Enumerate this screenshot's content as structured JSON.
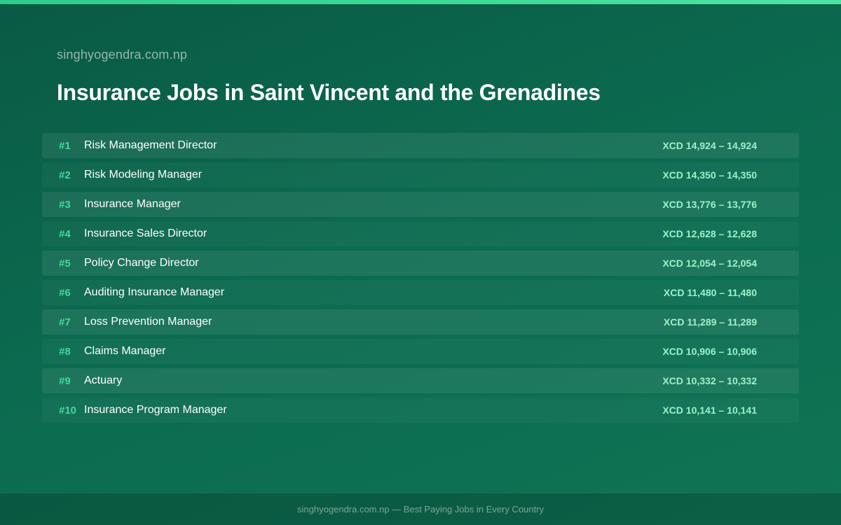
{
  "site": {
    "name": "singhyogendra.com.np"
  },
  "page": {
    "title": "Insurance Jobs in Saint Vincent and the Grenadines"
  },
  "colors": {
    "accent": "#43d99a",
    "salary": "#9ff0c9",
    "background": "#0b6a4f",
    "top_bar": "#3ddc97"
  },
  "jobs": [
    {
      "rank": "#1",
      "title": "Risk Management Director",
      "salary": "XCD 14,924 – 14,924"
    },
    {
      "rank": "#2",
      "title": "Risk Modeling Manager",
      "salary": "XCD 14,350 – 14,350"
    },
    {
      "rank": "#3",
      "title": "Insurance Manager",
      "salary": "XCD 13,776 – 13,776"
    },
    {
      "rank": "#4",
      "title": "Insurance Sales Director",
      "salary": "XCD 12,628 – 12,628"
    },
    {
      "rank": "#5",
      "title": "Policy Change Director",
      "salary": "XCD 12,054 – 12,054"
    },
    {
      "rank": "#6",
      "title": "Auditing Insurance Manager",
      "salary": "XCD 11,480 – 11,480"
    },
    {
      "rank": "#7",
      "title": "Loss Prevention Manager",
      "salary": "XCD 11,289 – 11,289"
    },
    {
      "rank": "#8",
      "title": "Claims Manager",
      "salary": "XCD 10,906 – 10,906"
    },
    {
      "rank": "#9",
      "title": "Actuary",
      "salary": "XCD 10,332 – 10,332"
    },
    {
      "rank": "#10",
      "title": "Insurance Program Manager",
      "salary": "XCD 10,141 – 10,141"
    }
  ],
  "footer": {
    "text": "singhyogendra.com.np — Best Paying Jobs in Every Country"
  }
}
